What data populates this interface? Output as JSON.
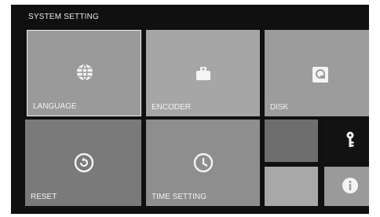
{
  "screen": {
    "title": "SYSTEM SETTING"
  },
  "tiles": [
    {
      "label": "LANGUAGE",
      "icon": "globe-icon",
      "selected": true
    },
    {
      "label": "ENCODER",
      "icon": "encoder-icon"
    },
    {
      "label": "DISK",
      "icon": "disk-icon"
    },
    {
      "label": "RESET",
      "icon": "reset-icon"
    },
    {
      "label": "TIME SETTING",
      "icon": "clock-icon"
    },
    {
      "label": "",
      "icon": ""
    },
    {
      "label": "",
      "icon": "key-icon"
    },
    {
      "label": "",
      "icon": ""
    },
    {
      "label": "",
      "icon": "info-icon"
    }
  ],
  "colors": {
    "background": "#101010",
    "tile_language": "#9a9a9a",
    "tile_encoder": "#a6a6a6",
    "tile_disk": "#9c9c9c",
    "tile_reset": "#7a7a7a",
    "tile_time": "#8e8e8e",
    "tile_dark_small": "#6e6e6e",
    "tile_light_small": "#a8a8a8",
    "text": "#f2f2f2"
  }
}
